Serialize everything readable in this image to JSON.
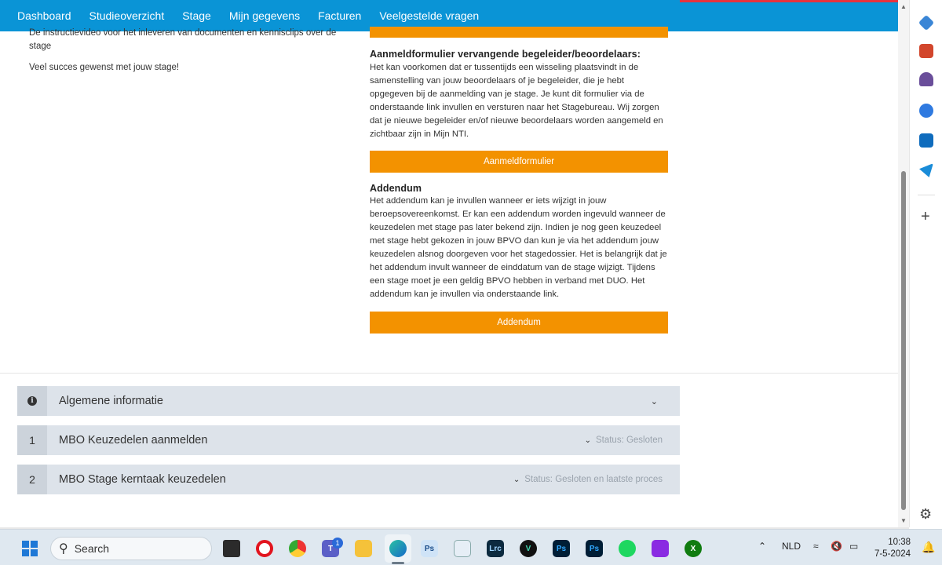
{
  "nav": {
    "items": [
      "Dashboard",
      "Studieoverzicht",
      "Stage",
      "Mijn gegevens",
      "Facturen",
      "Veelgestelde vragen"
    ]
  },
  "left": {
    "line1": "De instructievideo voor het inleveren van documenten en kennisclips over de stage",
    "line2": "Veel succes gewenst met jouw stage!"
  },
  "sections": {
    "replacement": {
      "title": "Aanmeldformulier vervangende begeleider/beoordelaars:",
      "text": "Het kan voorkomen dat er tussentijds een wisseling plaatsvindt in de samenstelling van jouw beoordelaars of je begeleider, die je hebt opgegeven bij de aanmelding van je stage. Je kunt dit formulier via de onderstaande link invullen en versturen naar het Stagebureau. Wij zorgen dat je nieuwe begeleider en/of nieuwe beoordelaars worden aangemeld en zichtbaar zijn in Mijn NTI.",
      "button": "Aanmeldformulier"
    },
    "addendum": {
      "title": "Addendum",
      "text": "Het addendum kan je invullen wanneer er iets wijzigt in jouw beroepsovereenkomst. Er kan een addendum worden ingevuld wanneer de keuzedelen met stage pas later bekend zijn. Indien je nog geen keuzedeel met stage hebt gekozen in jouw BPVO dan kun je via het addendum jouw keuzedelen alsnog doorgeven voor het stagedossier. Het is belangrijk dat je het addendum invult wanneer de einddatum van de stage wijzigt. Tijdens een stage moet je een geldig BPVO hebben in verband met DUO. Het addendum kan je invullen via onderstaande link.",
      "button": "Addendum"
    }
  },
  "accordion": [
    {
      "num": "",
      "title": "Algemene informatie",
      "status": ""
    },
    {
      "num": "1",
      "title": "MBO Keuzedelen aanmelden",
      "status": "Status: Gesloten"
    },
    {
      "num": "2",
      "title": "MBO Stage kerntaak keuzedelen",
      "status": "Status: Gesloten en laatste proces"
    }
  ],
  "taskbar": {
    "search": "Search",
    "teams_badge": "1",
    "lang": "NLD",
    "time": "10:38",
    "date": "7-5-2024",
    "apps": [
      "Ps",
      "Lrc",
      "Ps",
      "Ps"
    ]
  },
  "colors": {
    "nav": "#0a94d6",
    "accent": "#f39200",
    "accordion": "#dde3ea"
  }
}
